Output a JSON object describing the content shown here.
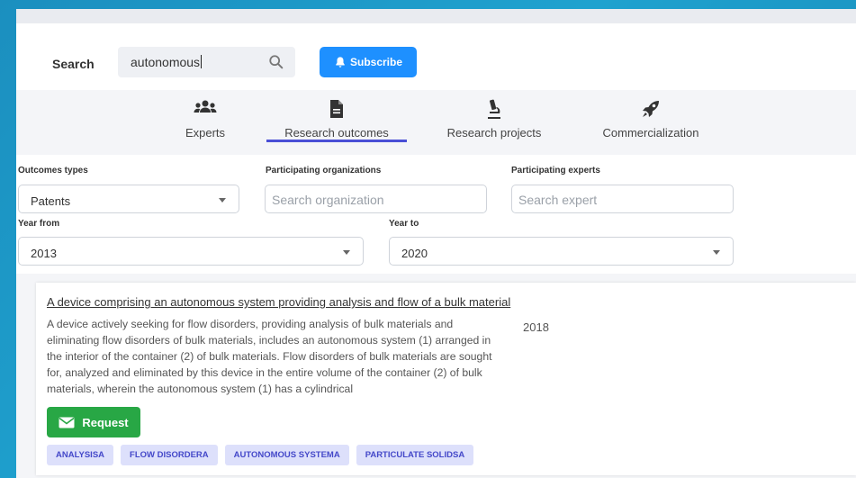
{
  "search": {
    "label": "Search",
    "value": "autonomous",
    "subscribe_label": "Subscribe"
  },
  "tabs": [
    {
      "label": "Experts",
      "icon": "users-icon"
    },
    {
      "label": "Research outcomes",
      "icon": "document-icon",
      "active": true
    },
    {
      "label": "Research projects",
      "icon": "microscope-icon"
    },
    {
      "label": "Commercialization",
      "icon": "rocket-icon"
    }
  ],
  "filters": {
    "outcome_types_label": "Outcomes types",
    "outcome_types_value": "Patents",
    "organizations_label": "Participating organizations",
    "organizations_placeholder": "Search organization",
    "experts_label": "Participating experts",
    "experts_placeholder": "Search expert",
    "year_from_label": "Year from",
    "year_from_value": "2013",
    "year_to_label": "Year to",
    "year_to_value": "2020"
  },
  "result": {
    "title": "A device comprising an autonomous system providing analysis and flow of a bulk material",
    "abstract": "A device actively seeking for flow disorders, providing analysis of bulk materials and eliminating flow disorders of bulk materials, includes an autonomous system (1) arranged in the interior of the container (2) of bulk materials. Flow disorders of bulk materials are sought for, analyzed and eliminated by this device in the entire volume of the container (2) of bulk materials, wherein the autonomous system (1) has a cylindrical",
    "year": "2018",
    "request_label": "Request",
    "tags": [
      "ANALYSISA",
      "FLOW DISORDERA",
      "AUTONOMOUS SYSTEMA",
      "PARTICULATE SOLIDSA"
    ]
  },
  "colors": {
    "subscribe": "#1e90ff",
    "request": "#28a745",
    "tab_underline": "#4a4fd6",
    "tag_bg": "#dde0fb",
    "tag_text": "#4448c9"
  }
}
